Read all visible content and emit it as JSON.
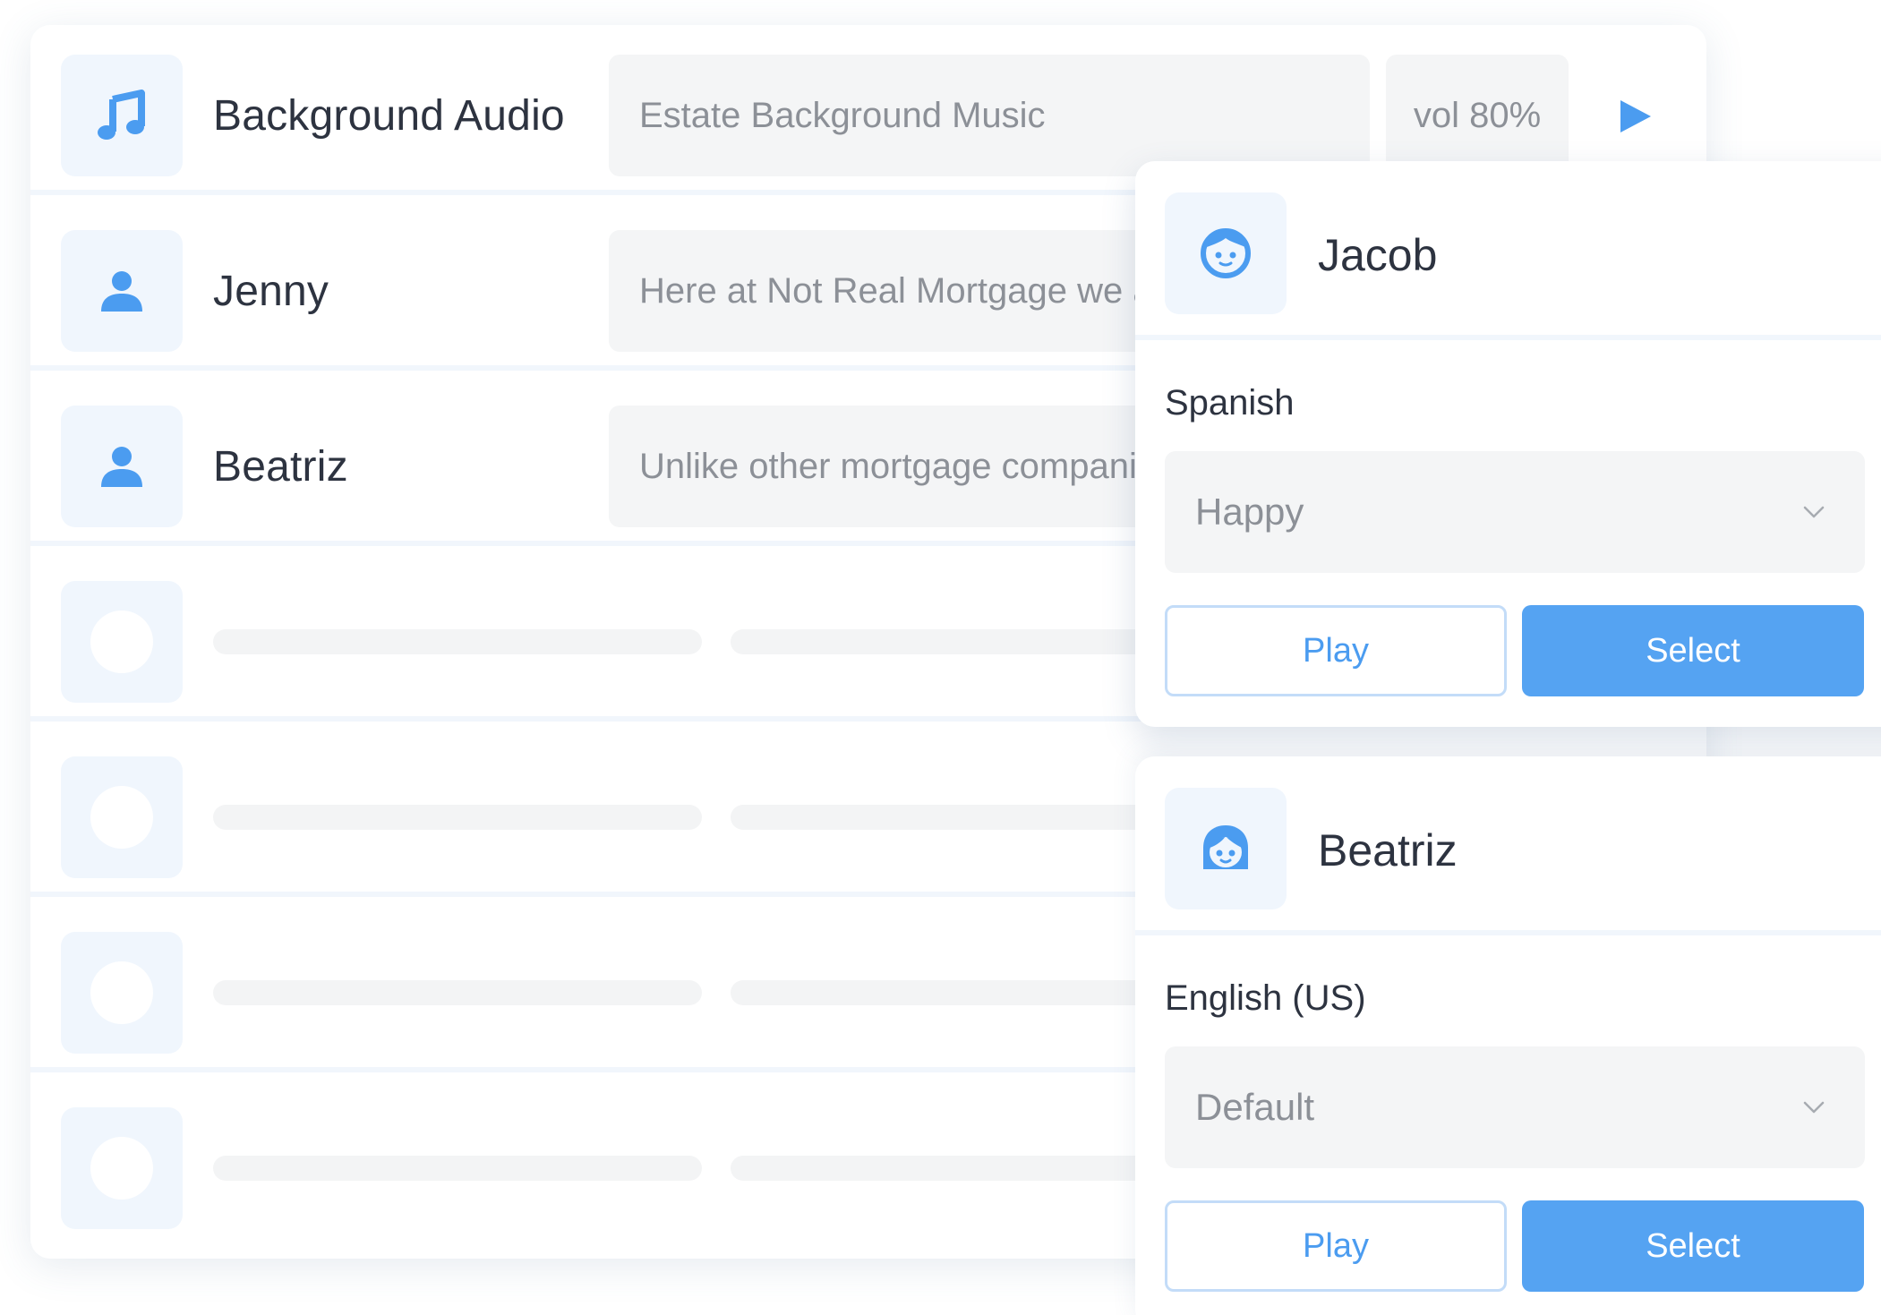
{
  "colors": {
    "accent": "#55a3f2",
    "icon_blue": "#4b9cf0",
    "tile_bg": "#f0f6fd",
    "field_bg": "#f4f5f6",
    "text_dark": "#2d3340",
    "text_muted": "#8c9097"
  },
  "tracks": [
    {
      "name": "Background Audio",
      "icon": "music-note-icon",
      "text": "Estate Background Music",
      "volume": "vol 80%",
      "play_icon": "play-triangle-icon"
    },
    {
      "name": "Jenny",
      "icon": "person-icon",
      "text": "Here at Not Real Mortgage we a"
    },
    {
      "name": "Beatriz",
      "icon": "person-icon",
      "text": "Unlike other mortgage compani"
    }
  ],
  "placeholder_rows": 4,
  "voice_cards": [
    {
      "name": "Jacob",
      "avatar_icon": "face-male-icon",
      "language": "Spanish",
      "style": "Happy",
      "play_label": "Play",
      "select_label": "Select"
    },
    {
      "name": "Beatriz",
      "avatar_icon": "face-female-icon",
      "language": "English (US)",
      "style": "Default",
      "play_label": "Play",
      "select_label": "Select"
    }
  ]
}
